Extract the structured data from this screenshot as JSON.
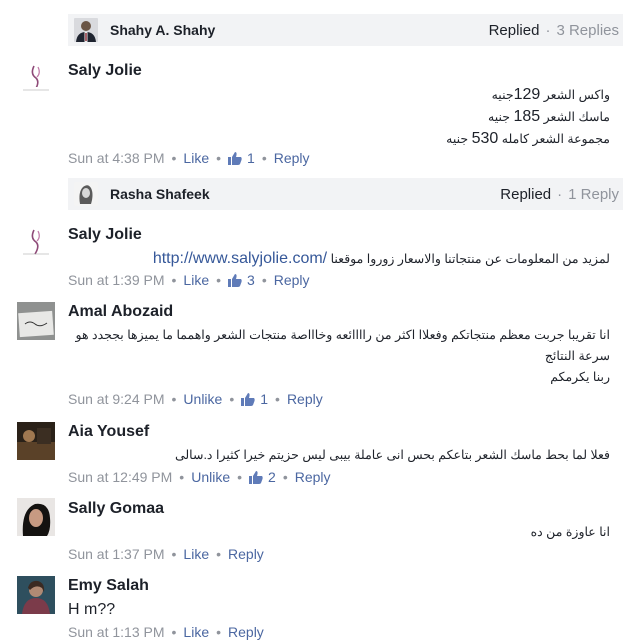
{
  "comments": [
    {
      "reply_preview": {
        "name": "Shahy A. Shahy",
        "status": "Replied",
        "count": "3 Replies"
      }
    },
    {
      "author": "Saly Jolie",
      "avatar_text": "Saly Jolie",
      "lines": [
        {
          "pre": "واكس الشعر ",
          "num": "129",
          "post": "جنيه"
        },
        {
          "pre": "ماسك الشعر ",
          "num": "185",
          "post": " جنيه"
        },
        {
          "pre": "مجموعة الشعر كامله ",
          "num": "530",
          "post": " جنيه"
        }
      ],
      "time": "Sun at 4:38 PM",
      "like_label": "Like",
      "likes": "1",
      "reply_label": "Reply",
      "reply_preview": {
        "name": "Rasha Shafeek",
        "status": "Replied",
        "count": "1 Reply"
      }
    },
    {
      "author": "Saly Jolie",
      "avatar_text": "Saly Jolie",
      "text": "لمزيد من المعلومات عن منتجاتنا والاسعار زوروا موقعنا",
      "link": "http://www.salyjolie.com/",
      "time": "Sun at 1:39 PM",
      "like_label": "Like",
      "likes": "3",
      "reply_label": "Reply"
    },
    {
      "author": "Amal Abozaid",
      "lines": [
        "انا تقريبا جربت معظم منتجاتكم وفعلاا اكثر من راااائعه وخاااصة منتجات الشعر واهمما ما يميزها بججدد هو",
        "سرعة النتائج",
        "ربنا يكرمكم"
      ],
      "time": "Sun at 9:24 PM",
      "like_label": "Unlike",
      "likes": "1",
      "reply_label": "Reply"
    },
    {
      "author": "Aia Yousef",
      "text": "فعلا لما بحط ماسك الشعر بتاعكم بحس انى عاملة بيبى ليس حزيتم خيرا كثيرا د.سالى",
      "time": "Sun at 12:49 PM",
      "like_label": "Unlike",
      "likes": "2",
      "reply_label": "Reply"
    },
    {
      "author": "Sally Gomaa",
      "text": "انا عاوزة من ده",
      "time": "Sun at 1:37 PM",
      "like_label": "Like",
      "reply_label": "Reply"
    },
    {
      "author": "Emy Salah",
      "text": "H m??",
      "time": "Sun at 1:13 PM",
      "like_label": "Like",
      "reply_label": "Reply"
    }
  ],
  "colors": {
    "link": "#365899",
    "meta": "#90949c",
    "action": "#4b67a1",
    "reply_bg": "#f2f3f5"
  },
  "icons": {
    "like": "thumbs-up-icon"
  }
}
